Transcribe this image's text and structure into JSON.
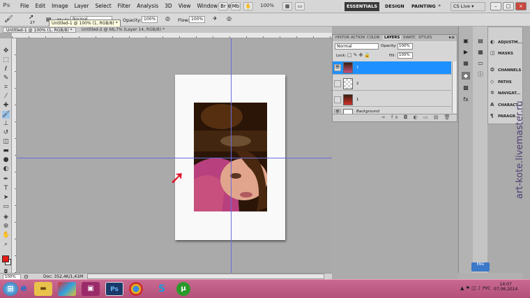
{
  "app": {
    "logo": "Ps"
  },
  "menu": {
    "items": [
      "File",
      "Edit",
      "Image",
      "Layer",
      "Select",
      "Filter",
      "Analysis",
      "3D",
      "View",
      "Window",
      "Help"
    ]
  },
  "zoom": "100%",
  "workspaces": {
    "active": "ESSENTIALS",
    "items": [
      "DESIGN",
      "PAINTING"
    ],
    "more": "»"
  },
  "cs_live": "CS Live ▾",
  "options": {
    "brush_size": "27",
    "mode_label": "Mode:",
    "mode_value": "Normal",
    "opacity_label": "Opacity:",
    "opacity_value": "100%",
    "flow_label": "Flow:",
    "flow_value": "100%"
  },
  "tooltip": "Untitled-1 @ 100% (1, RGB/8) *",
  "tabs": [
    "Untitled-1 @ 100% (1, RGB/8) *",
    "Untitled-2 @ 66,7% (Layer 14, RGB/8) *"
  ],
  "status": {
    "zoom": "100%",
    "doc": "Doc: 352,4K/1,41M"
  },
  "layers_panel": {
    "tabs": [
      "HISTOR",
      "ACTION",
      "COLOR",
      "LAYERS",
      "SWATC",
      "STYLES"
    ],
    "blend_mode": "Normal",
    "opacity_label": "Opacity:",
    "opacity_value": "100%",
    "lock_label": "Lock:",
    "fill_label": "Fill:",
    "fill_value": "100%",
    "layers": [
      {
        "name": "1",
        "selected": true
      },
      {
        "name": "2",
        "selected": false
      },
      {
        "name": "1",
        "selected": false
      },
      {
        "name": "Background",
        "selected": false
      }
    ]
  },
  "dock": {
    "items": [
      "ADJUSTM...",
      "MASKS",
      "CHANNELS",
      "PATHS",
      "NAVIGAT...",
      "CHARACT...",
      "PARAGR..."
    ],
    "icons": [
      "adjustments-icon",
      "masks-icon",
      "channels-icon",
      "paths-icon",
      "navigator-icon",
      "character-icon",
      "paragraph-icon"
    ]
  },
  "lang_badge": "ENG",
  "watermark": "art-kote.livemaster.ru",
  "taskbar": {
    "lang": "РУС",
    "time": "14:07",
    "date": "07.06.2014"
  },
  "colors": {
    "foreground": "#e31b17",
    "background": "#ffffff",
    "selected_layer": "#1e90ff",
    "taskbar": "#c1628a"
  }
}
